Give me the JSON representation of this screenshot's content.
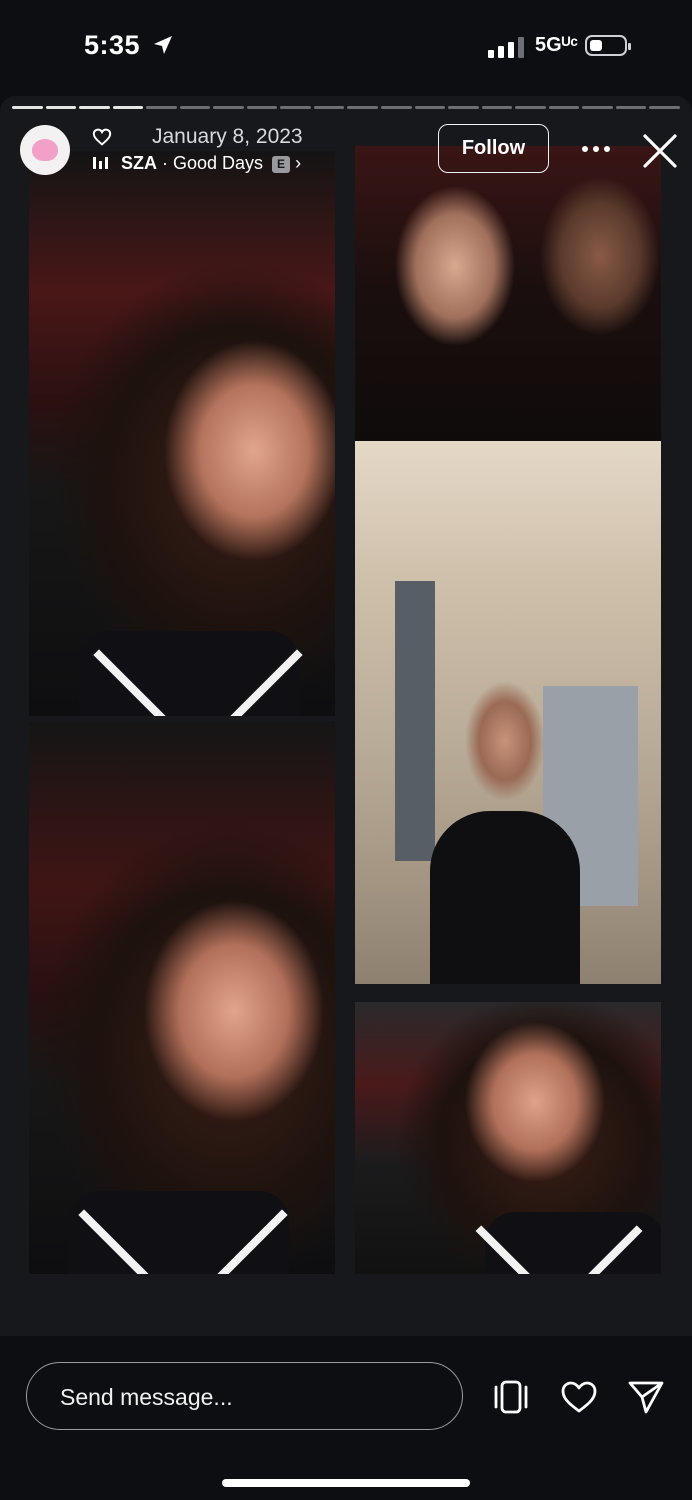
{
  "status_bar": {
    "time": "5:35",
    "network": "5Gᵁᶜ",
    "icons": [
      "location-arrow-icon",
      "signal-icon",
      "battery-icon"
    ]
  },
  "story": {
    "progress_segments": 20,
    "progress_completed": 4,
    "date": "January 8, 2023",
    "music": {
      "artist": "SZA",
      "separator": " · ",
      "title": "Good Days",
      "explicit_badge": "E",
      "chevron": "›"
    },
    "follow_label": "Follow",
    "colors": {
      "background": "#0c0e12",
      "panel": "#16181c",
      "accent_avatar": "#f2a0c8"
    }
  },
  "bottom_bar": {
    "message_placeholder": "Send message...",
    "icons": [
      "reels-icon",
      "like-heart-icon",
      "send-icon"
    ]
  }
}
